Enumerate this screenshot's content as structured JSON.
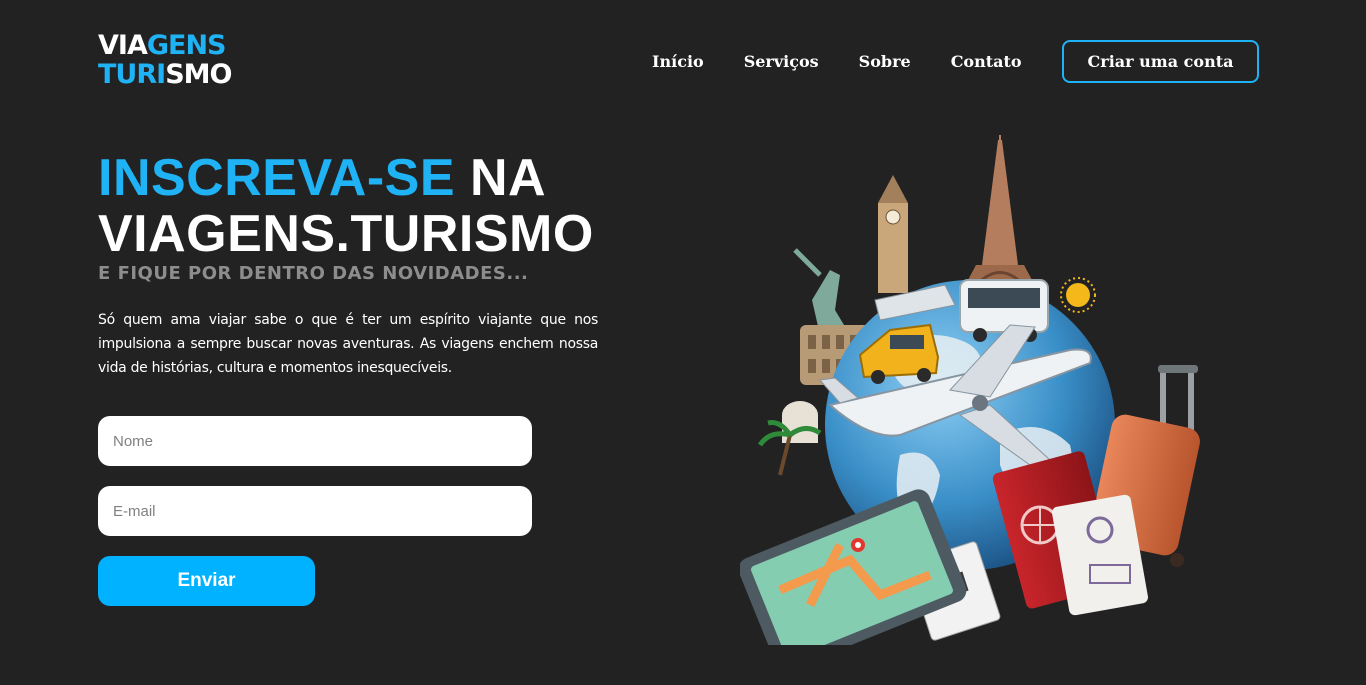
{
  "header": {
    "logo": {
      "line1_a": "VIA",
      "line1_b": "GENS",
      "line2_a": "TURI",
      "line2_b": "SMO"
    },
    "nav": [
      {
        "label": "Início"
      },
      {
        "label": "Serviços"
      },
      {
        "label": "Sobre"
      },
      {
        "label": "Contato"
      }
    ],
    "cta_label": "Criar uma conta"
  },
  "hero": {
    "headline_blue": "INSCREVA-SE",
    "headline_white": " NA",
    "headline_line2": "VIAGENS.TURISMO",
    "subhead": "E FIQUE POR DENTRO DAS NOVIDADES...",
    "description": "Só quem ama viajar sabe o que é ter um espírito viajante que nos impulsiona a sempre buscar novas aventuras. As viagens enchem nossa vida de histórias, cultura e momentos inesquecíveis."
  },
  "form": {
    "name_placeholder": "Nome",
    "email_placeholder": "E-mail",
    "submit_label": "Enviar"
  },
  "colors": {
    "background": "#222222",
    "accent": "#1fb3f5",
    "button": "#00b2ff",
    "subhead": "#8d8d8d"
  }
}
